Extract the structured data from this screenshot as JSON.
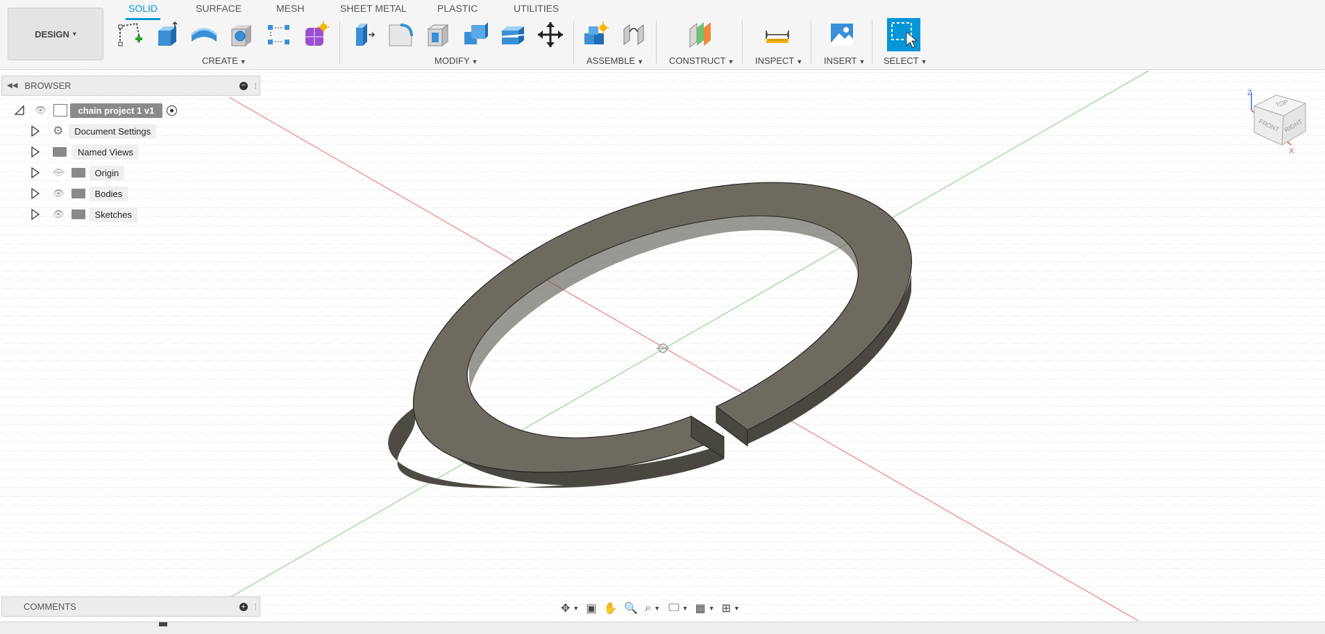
{
  "workspace": {
    "label": "DESIGN",
    "caret": "▾"
  },
  "tabs": [
    {
      "label": "SOLID"
    },
    {
      "label": "SURFACE"
    },
    {
      "label": "MESH"
    },
    {
      "label": "SHEET METAL"
    },
    {
      "label": "PLASTIC"
    },
    {
      "label": "UTILITIES"
    }
  ],
  "groups": {
    "create": "CREATE",
    "modify": "MODIFY",
    "assemble": "ASSEMBLE",
    "construct": "CONSTRUCT",
    "inspect": "INSPECT",
    "insert": "INSERT",
    "select": "SELECT"
  },
  "browser": {
    "title": "BROWSER",
    "root": "chain project 1 v1",
    "items": [
      {
        "label": "Document Settings",
        "icon": "gear-icon"
      },
      {
        "label": "Named Views",
        "icon": "folder-icon"
      },
      {
        "label": "Origin",
        "icon": "folder-icon"
      },
      {
        "label": "Bodies",
        "icon": "folder-icon"
      },
      {
        "label": "Sketches",
        "icon": "folder-icon"
      }
    ]
  },
  "comments": {
    "title": "COMMENTS"
  },
  "viewcube": {
    "top": "TOP",
    "front": "FRONT",
    "right": "RIGHT",
    "z": "Z",
    "x": "X"
  },
  "colors": {
    "accent": "#0696d7",
    "body": "#6e6a60",
    "x_axis": "#e8847a",
    "y_axis": "#8ed88a"
  }
}
